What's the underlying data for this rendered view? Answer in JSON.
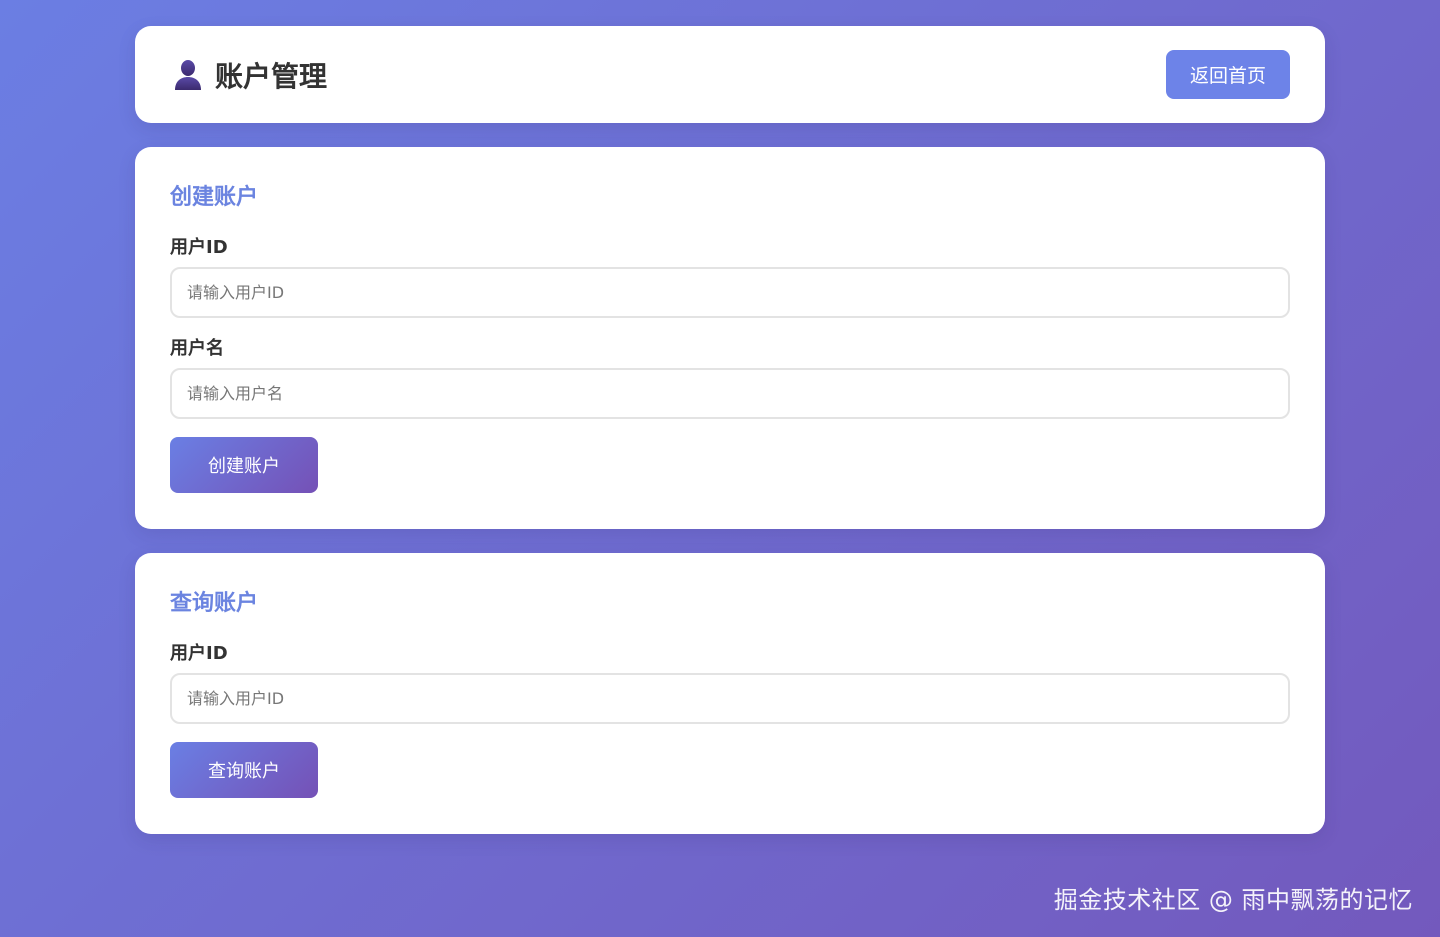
{
  "header": {
    "title": "账户管理",
    "icon": "user-icon",
    "home_button_label": "返回首页"
  },
  "create_section": {
    "title": "创建账户",
    "user_id_label": "用户ID",
    "user_id_placeholder": "请输入用户ID",
    "user_id_value": "",
    "username_label": "用户名",
    "username_placeholder": "请输入用户名",
    "username_value": "",
    "button_label": "创建账户"
  },
  "query_section": {
    "title": "查询账户",
    "user_id_label": "用户ID",
    "user_id_placeholder": "请输入用户ID",
    "user_id_value": "",
    "button_label": "查询账户"
  },
  "watermark": "掘金技术社区 @ 雨中飘荡的记忆",
  "colors": {
    "accent": "#6d83e8",
    "section_title": "#6b84e0",
    "gradient_start": "#6b7ee3",
    "gradient_end": "#7359bd"
  }
}
